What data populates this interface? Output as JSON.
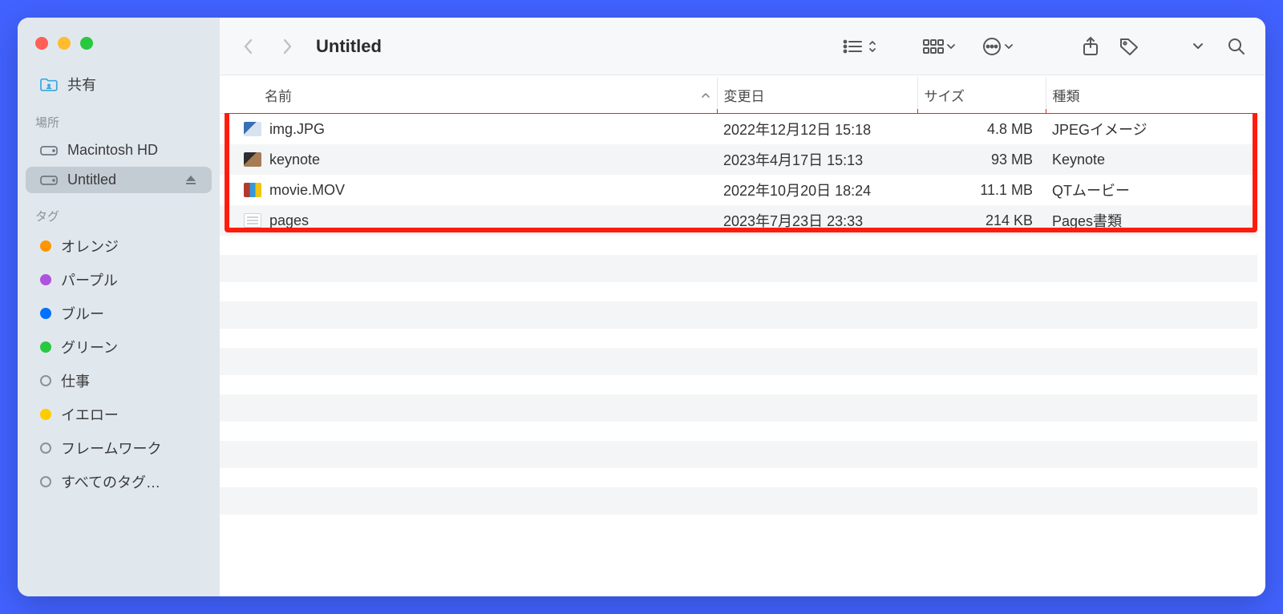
{
  "window_title": "Untitled",
  "sidebar": {
    "favorites": [
      {
        "label": "共有",
        "icon": "shared-folder"
      }
    ],
    "locations_header": "場所",
    "locations": [
      {
        "label": "Macintosh HD",
        "icon": "hdd",
        "selected": false,
        "ejectable": false
      },
      {
        "label": "Untitled",
        "icon": "hdd",
        "selected": true,
        "ejectable": true
      }
    ],
    "tags_header": "タグ",
    "tags": [
      {
        "label": "オレンジ",
        "color": "#ff9500"
      },
      {
        "label": "パープル",
        "color": "#af52de"
      },
      {
        "label": "ブルー",
        "color": "#0071ff"
      },
      {
        "label": "グリーン",
        "color": "#28c840"
      },
      {
        "label": "仕事",
        "open": true
      },
      {
        "label": "イエロー",
        "color": "#ffcc00"
      },
      {
        "label": "フレームワーク",
        "open": true
      },
      {
        "label": "すべてのタグ…",
        "open": true
      }
    ]
  },
  "columns": {
    "name": "名前",
    "modified": "変更日",
    "size": "サイズ",
    "kind": "種類"
  },
  "rows": [
    {
      "name": "img.JPG",
      "modified": "2022年12月12日 15:18",
      "size": "4.8 MB",
      "kind": "JPEGイメージ",
      "thumb": "jpeg"
    },
    {
      "name": "keynote",
      "modified": "2023年4月17日 15:13",
      "size": "93 MB",
      "kind": "Keynote",
      "thumb": "keynote"
    },
    {
      "name": "movie.MOV",
      "modified": "2022年10月20日 18:24",
      "size": "11.1 MB",
      "kind": "QTムービー",
      "thumb": "mov"
    },
    {
      "name": "pages",
      "modified": "2023年7月23日 23:33",
      "size": "214 KB",
      "kind": "Pages書類",
      "thumb": "pages"
    }
  ]
}
